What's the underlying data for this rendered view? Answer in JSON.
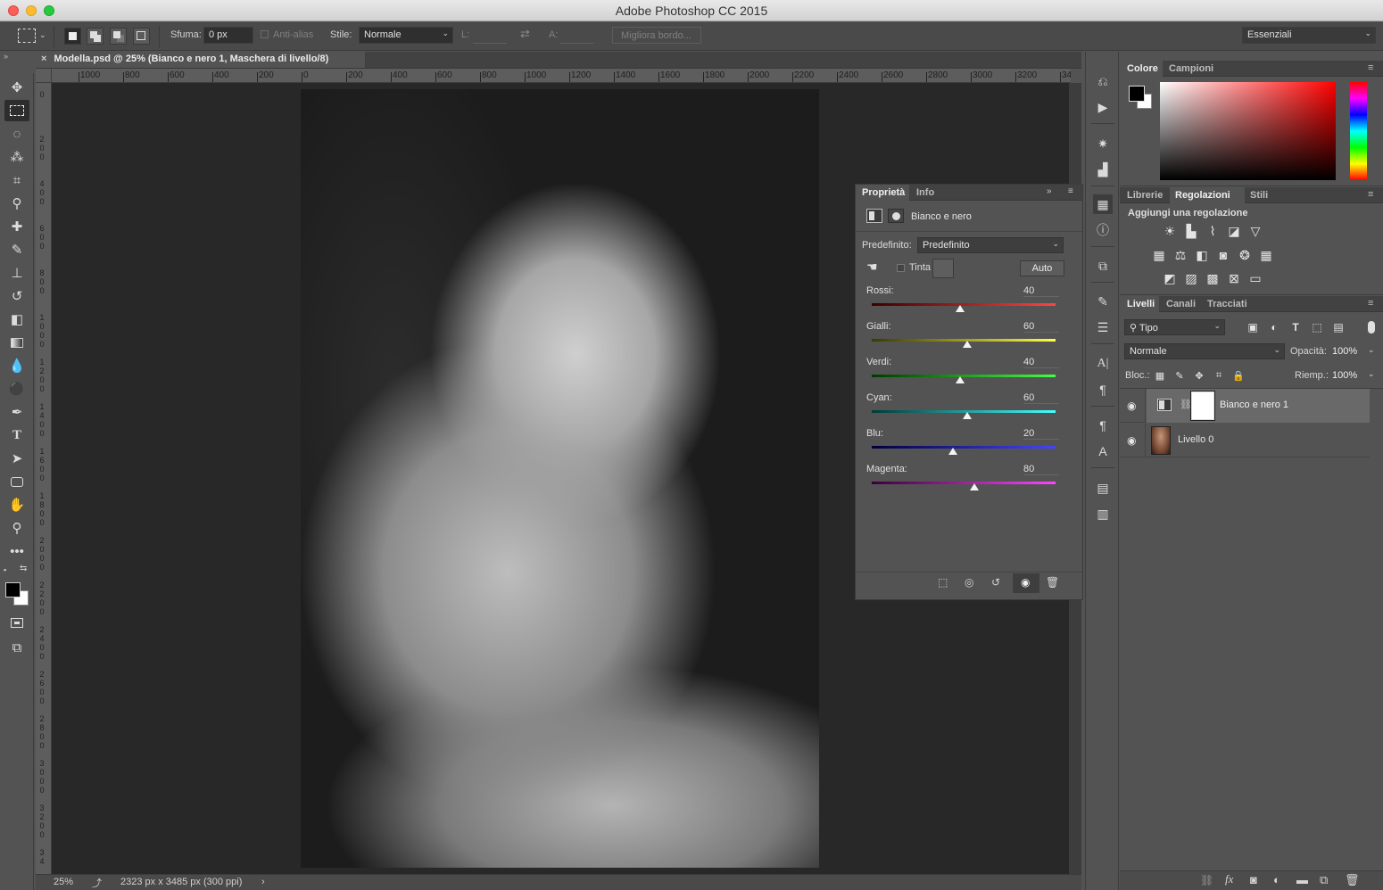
{
  "app": {
    "window_title": "Adobe Photoshop CC 2015"
  },
  "options_bar": {
    "feather_label": "Sfuma:",
    "feather_value": "0 px",
    "antialias_label": "Anti-alias",
    "style_label": "Stile:",
    "style_value": "Normale",
    "width_label": "L:",
    "height_label": "A:",
    "refine_edge_label": "Migliora bordo...",
    "workspace_value": "Essenziali"
  },
  "document": {
    "tab_title": "Modella.psd @ 25% (Bianco e nero 1, Maschera di livello/8)",
    "zoom": "25%",
    "doc_info": "2323 px x 3485 px (300 ppi)"
  },
  "ruler_h": [
    "1000",
    "800",
    "600",
    "400",
    "200",
    "0",
    "200",
    "400",
    "600",
    "800",
    "1000",
    "1200",
    "1400",
    "1600",
    "1800",
    "2000",
    "2200",
    "2400",
    "2600",
    "2800",
    "3000",
    "3200",
    "34"
  ],
  "ruler_v": [
    "0",
    "200",
    "400",
    "600",
    "800",
    "1000",
    "1200",
    "1400",
    "1600",
    "1800",
    "2000",
    "2200",
    "2400",
    "2600",
    "2800",
    "3000",
    "3200",
    "34"
  ],
  "properties": {
    "tab_properties": "Proprietà",
    "tab_info": "Info",
    "adjustment_name": "Bianco e nero",
    "preset_label": "Predefinito:",
    "preset_value": "Predefinito",
    "tint_label": "Tinta",
    "auto_label": "Auto",
    "sliders": [
      {
        "label": "Rossi",
        "value": "40",
        "pos": 0.48,
        "color": "linear-gradient(90deg,#3a0000,#ff4444)"
      },
      {
        "label": "Gialli",
        "value": "60",
        "pos": 0.52,
        "color": "linear-gradient(90deg,#3a3a00,#ffff44)"
      },
      {
        "label": "Verdi",
        "value": "40",
        "pos": 0.48,
        "color": "linear-gradient(90deg,#003a00,#44ff44)"
      },
      {
        "label": "Cyan",
        "value": "60",
        "pos": 0.52,
        "color": "linear-gradient(90deg,#003a3a,#44ffff)"
      },
      {
        "label": "Blu",
        "value": "20",
        "pos": 0.44,
        "color": "linear-gradient(90deg,#00003a,#4444ff)"
      },
      {
        "label": "Magenta",
        "value": "80",
        "pos": 0.56,
        "color": "linear-gradient(90deg,#3a003a,#ff44ff)"
      }
    ]
  },
  "color_panel": {
    "tab_color": "Colore",
    "tab_swatches": "Campioni"
  },
  "adjustments_panel": {
    "tab_libraries": "Librerie",
    "tab_adjustments": "Regolazioni",
    "tab_styles": "Stili",
    "add_adjustment": "Aggiungi una regolazione"
  },
  "layers_panel": {
    "tab_layers": "Livelli",
    "tab_channels": "Canali",
    "tab_paths": "Tracciati",
    "filter_kind": "Tipo",
    "blend_mode": "Normale",
    "opacity_label": "Opacità:",
    "opacity_value": "100%",
    "lock_label": "Bloc.:",
    "fill_label": "Riemp.:",
    "fill_value": "100%",
    "layers": [
      {
        "name": "Bianco e nero 1"
      },
      {
        "name": "Livello 0"
      }
    ]
  }
}
